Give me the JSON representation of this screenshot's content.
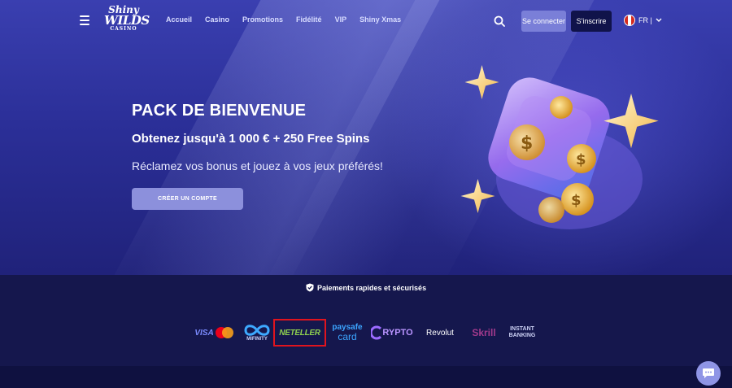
{
  "header": {
    "logo": {
      "line1": "Shiny",
      "line2": "WILDS",
      "line3": "CASINO"
    },
    "nav": [
      "Accueil",
      "Casino",
      "Promotions",
      "Fidélité",
      "VIP",
      "Shiny Xmas"
    ],
    "login_label": "Se connecter",
    "signup_label": "S'inscrire",
    "language": "FR |"
  },
  "hero": {
    "title": "PACK DE BIENVENUE",
    "subtitle": "Obtenez jusqu'à 1 000 € + 250 Free Spins",
    "description": "Réclamez vos bonus et jouez à vos jeux préférés!",
    "cta_label": "CRÉER UN COMPTE"
  },
  "payments": {
    "secure_text": "Paiements rapides et sécurisés",
    "methods": {
      "visa": "VISA",
      "mifinity": "MIFINITY",
      "neteller": "NETELLER",
      "paysafe_top": "paysafe",
      "paysafe_bottom": "card",
      "crypto": "RYPTO",
      "revolut": "Revolut",
      "skrill": "Skrill",
      "instant_top": "INSTANT",
      "instant_bottom": "BANKING"
    }
  },
  "colors": {
    "hero_bg": "#2b2f98",
    "payments_bg": "#15174d",
    "login_btn": "#7a7fd8",
    "signup_btn": "#10134a",
    "cta_btn": "#8c90dc",
    "highlight": "#e0141e"
  },
  "icons": [
    "menu-icon",
    "search-icon",
    "chevron-down-icon",
    "shield-check-icon",
    "chat-icon",
    "flag-icon"
  ]
}
